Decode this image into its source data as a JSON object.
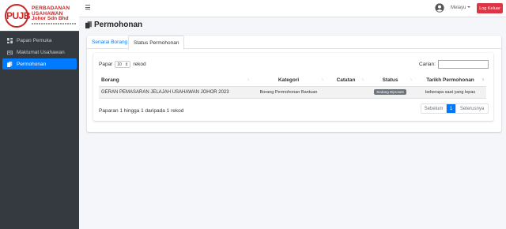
{
  "brand": {
    "logo_letters": "PUJB",
    "line1": "PERBADANAN",
    "line2": "USAHAWAN",
    "line3": "Johor Sdn Bhd"
  },
  "sidebar": {
    "items": [
      {
        "label": "Papan Pemuka",
        "icon": "dashboard-icon",
        "active": false
      },
      {
        "label": "Maklumat Usahawan",
        "icon": "id-card-icon",
        "active": false
      },
      {
        "label": "Permohonan",
        "icon": "copy-icon",
        "active": true
      }
    ]
  },
  "topbar": {
    "language": "Melayu",
    "logout_label": "Log Keluar",
    "logout_color": "#dc3545"
  },
  "page": {
    "title": "Permohonan"
  },
  "tabs": [
    {
      "label": "Senarai Borang",
      "active": false
    },
    {
      "label": "Status Permohonan",
      "active": true
    }
  ],
  "table_controls": {
    "length_prefix": "Papar",
    "length_value": "10",
    "length_suffix": "rekod",
    "search_label": "Carian:",
    "search_value": ""
  },
  "table": {
    "columns": [
      "Borang",
      "Kategori",
      "Catatan",
      "Status",
      "Tarikh Permohonan"
    ],
    "rows": [
      {
        "borang": "GERAN PEMASARAN JELAJAH USAHAWAN JOHOR 2023",
        "kategori": "Borang Permohonan Bantuan",
        "catatan": "",
        "status": "Sedang Diproses",
        "tarikh": "beberapa saat yang lepas"
      }
    ]
  },
  "footer": {
    "info": "Paparan 1 hingga 1 daripada 1 rekod",
    "prev": "Sebelum",
    "page": "1",
    "next": "Seterusnya"
  },
  "colors": {
    "accent": "#007bff",
    "sidebar_bg": "#343a40",
    "badge": "#6c757d"
  }
}
